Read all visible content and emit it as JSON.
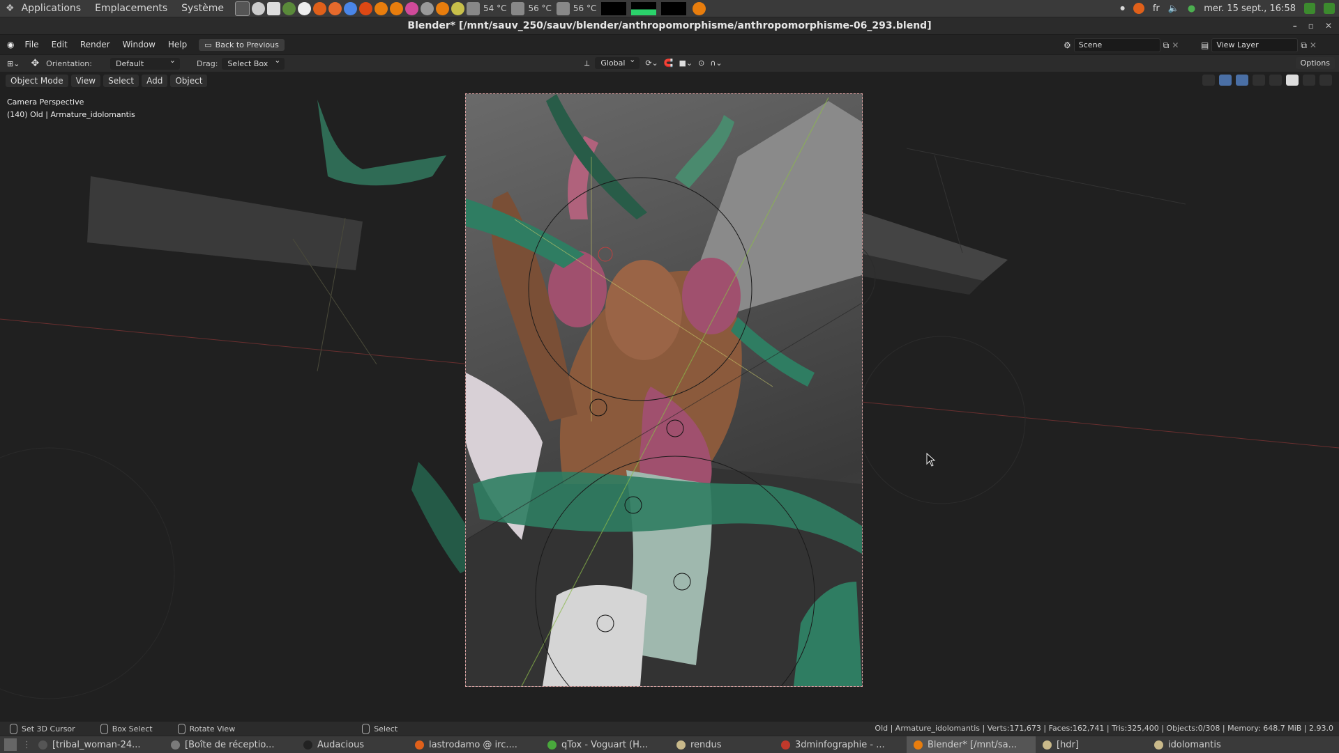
{
  "system_panel": {
    "menus": [
      "Applications",
      "Emplacements",
      "Système"
    ],
    "temps": [
      "54 °C",
      "56 °C",
      "56 °C"
    ],
    "keyboard_layout": "fr",
    "datetime": "mer. 15 sept., 16:58"
  },
  "window": {
    "title": "Blender* [/mnt/sauv_250/sauv/blender/anthropomorphisme/anthropomorphisme-06_293.blend]",
    "controls": [
      "–",
      "▫",
      "✕"
    ]
  },
  "topbar": {
    "menus": [
      "File",
      "Edit",
      "Render",
      "Window",
      "Help"
    ],
    "back_button": "Back to Previous",
    "scene_label": "Scene",
    "view_layer_label": "View Layer"
  },
  "header": {
    "orientation_label": "Orientation:",
    "orientation_value": "Default",
    "drag_label": "Drag:",
    "drag_value": "Select Box",
    "transform_orientation": "Global",
    "options_label": "Options"
  },
  "viewport": {
    "mode": "Object Mode",
    "menus": [
      "View",
      "Select",
      "Add",
      "Object"
    ],
    "info_line1": "Camera Perspective",
    "info_line2": "(140) Old | Armature_idolomantis"
  },
  "statusbar": {
    "items": [
      "Set 3D Cursor",
      "Box Select",
      "Rotate View",
      "Select"
    ],
    "stats": "Old | Armature_idolomantis | Verts:171,673 | Faces:162,741 | Tris:325,400 | Objects:0/308 | Memory: 648.7 MiB | 2.93.0"
  },
  "taskbar": {
    "tasks": [
      {
        "label": "[tribal_woman-24...",
        "color": "#555555"
      },
      {
        "label": "[Boîte de réceptio...",
        "color": "#7a7a7a"
      },
      {
        "label": "Audacious",
        "color": "#222222"
      },
      {
        "label": "lastrodamo @ irc....",
        "color": "#e0601a"
      },
      {
        "label": "qTox - Voguart (H...",
        "color": "#49a83c"
      },
      {
        "label": "rendus",
        "color": "#c9b98a"
      },
      {
        "label": "3dminfographie - ...",
        "color": "#c0392b"
      },
      {
        "label": "Blender* [/mnt/sa...",
        "color": "#e87d0d"
      },
      {
        "label": "[hdr]",
        "color": "#c9b98a"
      },
      {
        "label": "idolomantis",
        "color": "#c9b98a"
      }
    ],
    "active_index": 7
  },
  "colors": {
    "accent": "#e87d0d",
    "camera_frame": "#d9a0a0",
    "figure_green": "#2f7d62",
    "figure_pink": "#a0506e"
  }
}
